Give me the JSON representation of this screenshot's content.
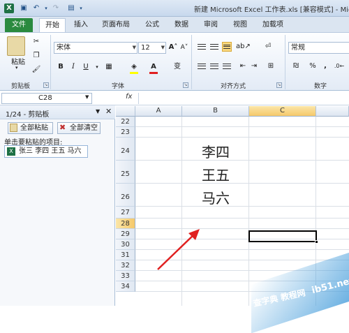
{
  "titlebar": {
    "title": "新建 Microsoft Excel 工作表.xls  [兼容模式]  - Mic",
    "logo_letter": "X"
  },
  "tabs": [
    "文件",
    "开始",
    "插入",
    "页面布局",
    "公式",
    "数据",
    "审阅",
    "视图",
    "加载项"
  ],
  "ribbon": {
    "clipboard": {
      "paste_label": "粘贴",
      "group_label": "剪贴板"
    },
    "font": {
      "name": "宋体",
      "size": "12",
      "group_label": "字体",
      "bold": "B",
      "italic": "I",
      "underline": "U",
      "font_color_letter": "A",
      "wen": "变"
    },
    "alignment": {
      "group_label": "对齐方式"
    },
    "number": {
      "format": "常规",
      "group_label": "数字",
      "percent": "%",
      "comma": ","
    }
  },
  "formula_bar": {
    "name_box": "C28",
    "fx": "fx"
  },
  "clipboard_pane": {
    "title": "1/24 - 剪贴板",
    "paste_all": "全部粘贴",
    "clear_all": "全部清空",
    "hint": "单击要粘贴的项目:",
    "items": [
      "张三 李四 王五 马六"
    ]
  },
  "sheet": {
    "columns": [
      "A",
      "B",
      "C"
    ],
    "rows": [
      "22",
      "23",
      "24",
      "25",
      "26",
      "27",
      "28",
      "29",
      "30",
      "31",
      "32",
      "33",
      "34"
    ],
    "active_row": "28",
    "active_col": "C",
    "selected_cell": "C28",
    "cells": {
      "B24": "李四",
      "B25": "王五",
      "B26": "马六"
    }
  },
  "watermark": {
    "line1": "ib51.net",
    "line2": "查字典 教程网"
  },
  "colors": {
    "file_tab": "#2a8a3f",
    "active_header": "#f9d77e",
    "arrow": "#e02020"
  }
}
